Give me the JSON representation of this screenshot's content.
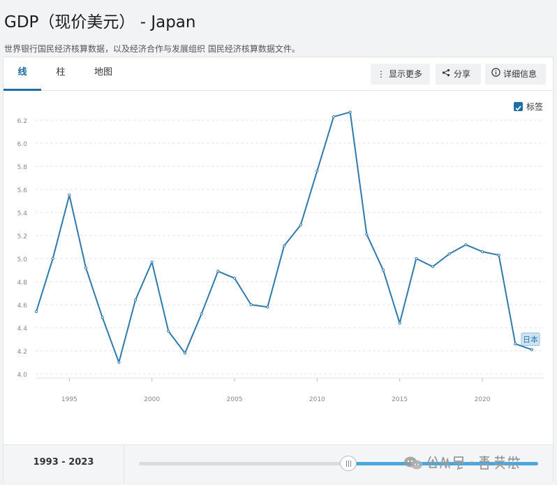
{
  "page": {
    "title": "GDP（现价美元） - Japan",
    "subtitle": "世界银行国民经济核算数据，以及经济合作与发展组织 国民经济核算数据文件。"
  },
  "tabs": [
    {
      "label": "线",
      "active": true
    },
    {
      "label": "柱",
      "active": false
    },
    {
      "label": "地图",
      "active": false
    }
  ],
  "toolbar": {
    "more_label": "显示更多",
    "more_icon": "more-vertical-icon",
    "share_label": "分享",
    "share_icon": "share-icon",
    "details_label": "详细信息",
    "details_icon": "info-icon"
  },
  "legend": {
    "checked": true,
    "label": "标签"
  },
  "colors": {
    "line": "#2f79ad",
    "accent": "#1c6ea4",
    "slider": "#4aa7de"
  },
  "chart_data": {
    "type": "line",
    "title": "",
    "xlabel": "",
    "ylabel": "",
    "x": [
      1993,
      1994,
      1995,
      1996,
      1997,
      1998,
      1999,
      2000,
      2001,
      2002,
      2003,
      2004,
      2005,
      2006,
      2007,
      2008,
      2009,
      2010,
      2011,
      2012,
      2013,
      2014,
      2015,
      2016,
      2017,
      2018,
      2019,
      2020,
      2021,
      2022,
      2023
    ],
    "series": [
      {
        "name": "日本",
        "values": [
          4.54,
          5.0,
          5.55,
          4.92,
          4.49,
          4.1,
          4.64,
          4.97,
          4.37,
          4.18,
          4.52,
          4.89,
          4.83,
          4.6,
          4.58,
          5.11,
          5.29,
          5.76,
          6.23,
          6.27,
          5.21,
          4.9,
          4.44,
          5.0,
          4.93,
          5.04,
          5.12,
          5.06,
          5.03,
          4.26,
          4.21
        ]
      }
    ],
    "yticks": [
      "4.0",
      "4.2",
      "4.4",
      "4.6",
      "4.8",
      "5.0",
      "5.2",
      "5.4",
      "5.6",
      "5.8",
      "6.0",
      "6.2"
    ],
    "xticks": [
      "1995",
      "2000",
      "2005",
      "2010",
      "2015",
      "2020"
    ],
    "ylim": [
      4.0,
      6.2
    ],
    "grid": true
  },
  "footer": {
    "range_start": "1993",
    "range_sep": " - ",
    "range_end": "2023",
    "range_fraction": 0.53
  },
  "watermark": "公众号 · 君莫愁"
}
